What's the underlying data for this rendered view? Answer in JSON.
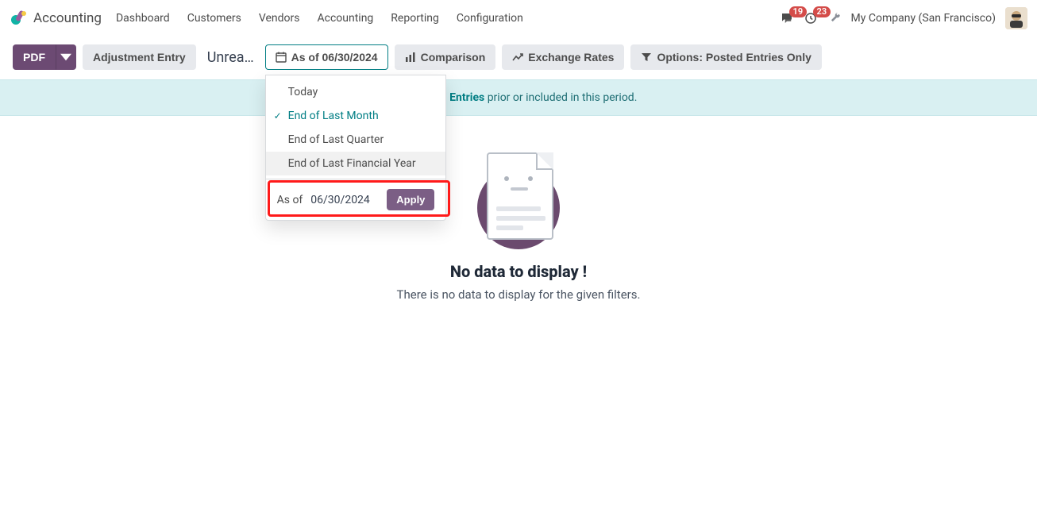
{
  "brand": "Accounting",
  "menu": [
    "Dashboard",
    "Customers",
    "Vendors",
    "Accounting",
    "Reporting",
    "Configuration"
  ],
  "notifications": {
    "chat": "19",
    "activity": "23"
  },
  "company": "My Company (San Francisco)",
  "toolbar": {
    "pdf": "PDF",
    "adjustment": "Adjustment Entry",
    "breadcrumb": "Unrea…",
    "asof": "As of 06/30/2024",
    "comparison": "Comparison",
    "exchange": "Exchange Rates",
    "options": "Options: Posted Entries Only"
  },
  "date_dropdown": {
    "items": [
      "Today",
      "End of Last Month",
      "End of Last Quarter",
      "End of Last Financial Year"
    ],
    "selected_index": 1,
    "hover_index": 3,
    "asof_label": "As of",
    "asof_value": "06/30/2024",
    "apply": "Apply"
  },
  "banner": {
    "mid": "d Journal Entries",
    "suffix": " prior or included in this period."
  },
  "empty": {
    "title": "No data to display !",
    "subtitle": "There is no data to display for the given filters."
  }
}
